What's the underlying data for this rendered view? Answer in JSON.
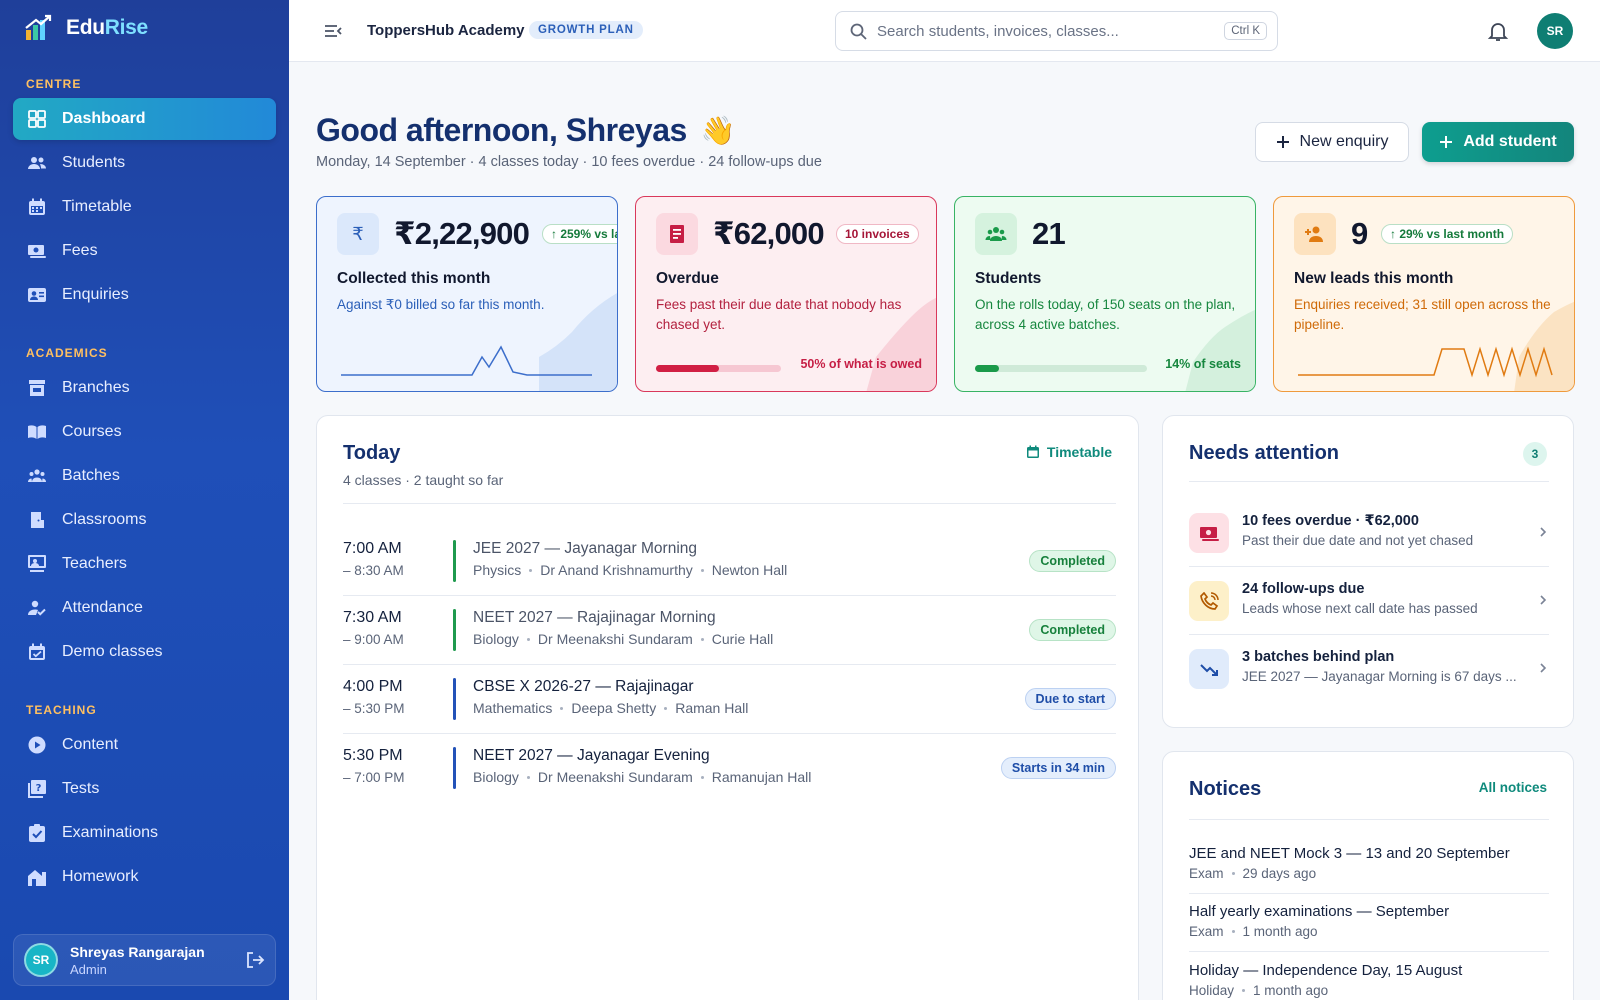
{
  "brand": {
    "name_part1": "Edu",
    "name_part2": "Rise"
  },
  "sidebar": {
    "sections": [
      {
        "label": "CENTRE"
      },
      {
        "label": "ACADEMICS"
      },
      {
        "label": "TEACHING"
      }
    ],
    "items": [
      {
        "label": "Dashboard",
        "icon": "grid-icon"
      },
      {
        "label": "Students",
        "icon": "users-icon"
      },
      {
        "label": "Timetable",
        "icon": "calendar-icon"
      },
      {
        "label": "Fees",
        "icon": "cash-icon"
      },
      {
        "label": "Enquiries",
        "icon": "contact-card-icon"
      },
      {
        "label": "Branches",
        "icon": "store-icon"
      },
      {
        "label": "Courses",
        "icon": "book-icon"
      },
      {
        "label": "Batches",
        "icon": "group-icon"
      },
      {
        "label": "Classrooms",
        "icon": "door-icon"
      },
      {
        "label": "Teachers",
        "icon": "teacher-icon"
      },
      {
        "label": "Attendance",
        "icon": "user-check-icon"
      },
      {
        "label": "Demo classes",
        "icon": "calendar-check-icon"
      },
      {
        "label": "Content",
        "icon": "play-circle-icon"
      },
      {
        "label": "Tests",
        "icon": "quiz-icon"
      },
      {
        "label": "Examinations",
        "icon": "clipboard-check-icon"
      },
      {
        "label": "Homework",
        "icon": "house-icon"
      }
    ],
    "user": {
      "initials": "SR",
      "name": "Shreyas Rangarajan",
      "role": "Admin"
    }
  },
  "topbar": {
    "org": "ToppersHub Academy",
    "plan": "GROWTH PLAN",
    "search_placeholder": "Search students, invoices, classes...",
    "shortcut": "Ctrl K",
    "avatar_initials": "SR"
  },
  "header": {
    "greeting": "Good afternoon, Shreyas",
    "wave": "👋",
    "subline": "Monday, 14 September · 4 classes today · 10 fees overdue · 24 follow-ups due",
    "new_enquiry": "New enquiry",
    "add_student": "Add student"
  },
  "stats": [
    {
      "amount": "₹2,22,900",
      "chip": "↑ 259% vs la",
      "label": "Collected this month",
      "desc": "Against ₹0 billed so far this month.",
      "color": "#2b5fb8"
    },
    {
      "amount": "₹62,000",
      "chip": "10 invoices",
      "label": "Overdue",
      "desc": "Fees past their due date that nobody has chased yet.",
      "progress": 0.5,
      "bar_caption": "50% of what is owed",
      "color": "#c61e45"
    },
    {
      "amount": "21",
      "label": "Students",
      "desc": "On the rolls today, of 150 seats on the plan, across 4 active batches.",
      "progress": 0.14,
      "bar_caption": "14% of seats",
      "color": "#1a9a4a"
    },
    {
      "amount": "9",
      "chip": "↑ 29% vs last month",
      "label": "New leads this month",
      "desc": "Enquiries received; 31 still open across the pipeline.",
      "color": "#e07b12"
    }
  ],
  "today": {
    "title": "Today",
    "sub": "4 classes · 2 taught so far",
    "link": "Timetable",
    "classes": [
      {
        "start": "7:00 AM",
        "end": "– 8:30 AM",
        "name": "JEE 2027 — Jayanagar Morning",
        "subject": "Physics",
        "teacher": "Dr Anand Krishnamurthy",
        "room": "Newton Hall",
        "status": "Completed",
        "kind": "done"
      },
      {
        "start": "7:30 AM",
        "end": "– 9:00 AM",
        "name": "NEET 2027 — Rajajinagar Morning",
        "subject": "Biology",
        "teacher": "Dr Meenakshi Sundaram",
        "room": "Curie Hall",
        "status": "Completed",
        "kind": "done"
      },
      {
        "start": "4:00 PM",
        "end": "– 5:30 PM",
        "name": "CBSE X 2026-27 — Rajajinagar",
        "subject": "Mathematics",
        "teacher": "Deepa Shetty",
        "room": "Raman Hall",
        "status": "Due to start",
        "kind": "upcoming"
      },
      {
        "start": "5:30 PM",
        "end": "– 7:00 PM",
        "name": "NEET 2027 — Jayanagar Evening",
        "subject": "Biology",
        "teacher": "Dr Meenakshi Sundaram",
        "room": "Ramanujan Hall",
        "status": "Starts in 34 min",
        "kind": "upcoming"
      }
    ]
  },
  "attention": {
    "title": "Needs attention",
    "count": "3",
    "items": [
      {
        "title": "10 fees overdue · ₹62,000",
        "sub": "Past their due date and not yet chased"
      },
      {
        "title": "24 follow-ups due",
        "sub": "Leads whose next call date has passed"
      },
      {
        "title": "3 batches behind plan",
        "sub": "JEE 2027 — Jayanagar Morning is 67 days ..."
      }
    ]
  },
  "notices": {
    "title": "Notices",
    "link": "All notices",
    "items": [
      {
        "title": "JEE and NEET Mock 3 — 13 and 20 September",
        "tag": "Exam",
        "age": "29 days ago"
      },
      {
        "title": "Half yearly examinations — September",
        "tag": "Exam",
        "age": "1 month ago"
      },
      {
        "title": "Holiday — Independence Day, 15 August",
        "tag": "Holiday",
        "age": "1 month ago"
      }
    ]
  }
}
